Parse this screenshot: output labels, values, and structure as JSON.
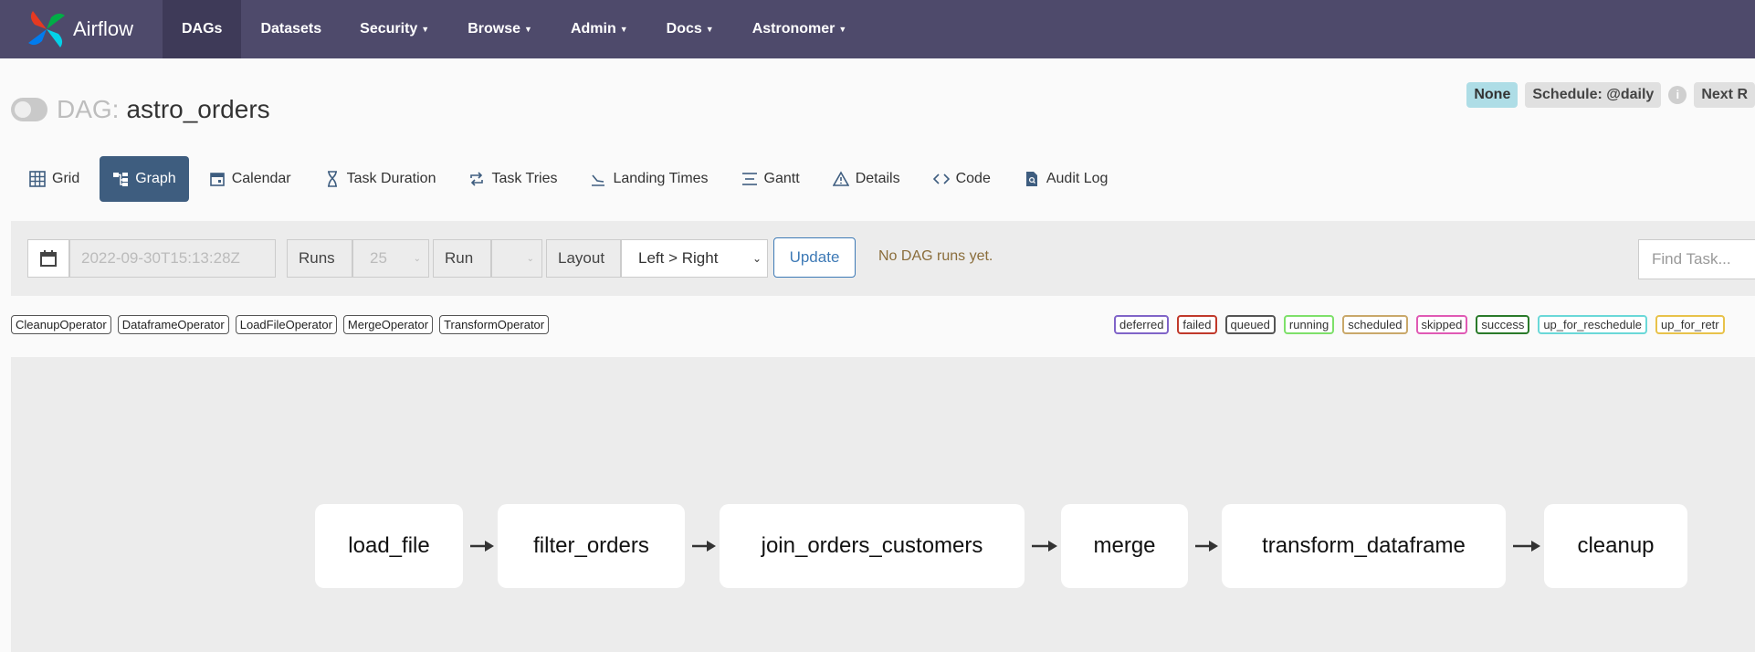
{
  "brand": {
    "name": "Airflow"
  },
  "nav": {
    "items": [
      {
        "label": "DAGs",
        "active": true,
        "dropdown": false
      },
      {
        "label": "Datasets",
        "active": false,
        "dropdown": false
      },
      {
        "label": "Security",
        "active": false,
        "dropdown": true
      },
      {
        "label": "Browse",
        "active": false,
        "dropdown": true
      },
      {
        "label": "Admin",
        "active": false,
        "dropdown": true
      },
      {
        "label": "Docs",
        "active": false,
        "dropdown": true
      },
      {
        "label": "Astronomer",
        "active": false,
        "dropdown": true
      }
    ]
  },
  "dag": {
    "prefix": "DAG:",
    "id": "astro_orders",
    "paused": true
  },
  "schedule": {
    "none_badge": "None",
    "schedule_label": "Schedule: @daily",
    "next_run_label": "Next R"
  },
  "tabs": [
    {
      "label": "Grid",
      "icon": "grid-icon",
      "active": false
    },
    {
      "label": "Graph",
      "icon": "graph-icon",
      "active": true
    },
    {
      "label": "Calendar",
      "icon": "calendar-icon",
      "active": false
    },
    {
      "label": "Task Duration",
      "icon": "hourglass-icon",
      "active": false
    },
    {
      "label": "Task Tries",
      "icon": "repeat-icon",
      "active": false
    },
    {
      "label": "Landing Times",
      "icon": "landing-icon",
      "active": false
    },
    {
      "label": "Gantt",
      "icon": "gantt-icon",
      "active": false
    },
    {
      "label": "Details",
      "icon": "warning-triangle-icon",
      "active": false
    },
    {
      "label": "Code",
      "icon": "code-icon",
      "active": false
    },
    {
      "label": "Audit Log",
      "icon": "file-search-icon",
      "active": false
    }
  ],
  "controls": {
    "date_value": "2022-09-30T15:13:28Z",
    "runs_label": "Runs",
    "runs_value": "25",
    "run_label": "Run",
    "run_value": "",
    "layout_label": "Layout",
    "layout_value": "Left > Right",
    "update_label": "Update",
    "status_message": "No DAG runs yet.",
    "find_task_placeholder": "Find Task..."
  },
  "operators": [
    "CleanupOperator",
    "DataframeOperator",
    "LoadFileOperator",
    "MergeOperator",
    "TransformOperator"
  ],
  "states": [
    {
      "label": "deferred",
      "color": "#8064c8"
    },
    {
      "label": "failed",
      "color": "#c0392b"
    },
    {
      "label": "queued",
      "color": "#555555"
    },
    {
      "label": "running",
      "color": "#7ee06a"
    },
    {
      "label": "scheduled",
      "color": "#c9a86a"
    },
    {
      "label": "skipped",
      "color": "#e05ab4"
    },
    {
      "label": "success",
      "color": "#2a7a2a"
    },
    {
      "label": "up_for_reschedule",
      "color": "#6ad8d8"
    },
    {
      "label": "up_for_retr",
      "color": "#e8c24a"
    }
  ],
  "graph": {
    "nodes": [
      "load_file",
      "filter_orders",
      "join_orders_customers",
      "merge",
      "transform_dataframe",
      "cleanup"
    ]
  },
  "colors": {
    "navbar": "#4e4a6b",
    "active_tab": "#3e5d7f",
    "update": "#3e7ab6"
  }
}
